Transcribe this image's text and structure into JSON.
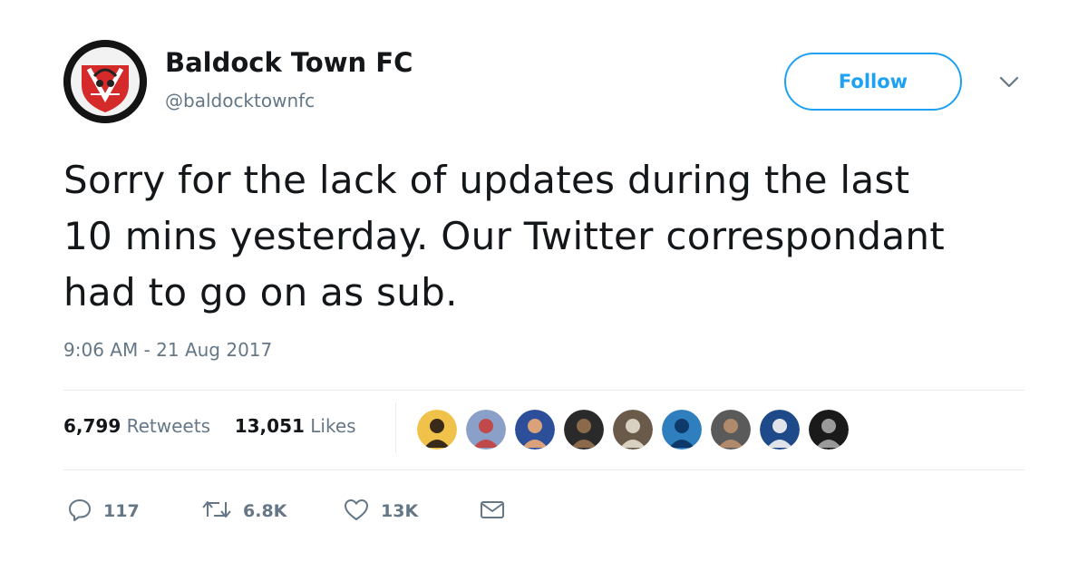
{
  "tweet": {
    "author": {
      "display_name": "Baldock Town FC",
      "handle": "@baldocktownfc",
      "avatar_icon": "club-crest"
    },
    "follow_label": "Follow",
    "menu_icon": "chevron-down-icon",
    "text": "Sorry for the lack of updates during the last\n10 mins yesterday. Our Twitter correspondant\nhad to go on as sub.",
    "timestamp": "9:06 AM - 21 Aug 2017",
    "stats": {
      "retweets_count": "6,799",
      "retweets_label": "Retweets",
      "likes_count": "13,051",
      "likes_label": "Likes"
    },
    "liker_avatars": [
      {
        "colors": [
          "#f0c24a",
          "#3a2a1a"
        ]
      },
      {
        "colors": [
          "#8aa0c8",
          "#c04a4a"
        ]
      },
      {
        "colors": [
          "#2d4f9a",
          "#d9a27a"
        ]
      },
      {
        "colors": [
          "#2a2a2a",
          "#8a6a4a"
        ]
      },
      {
        "colors": [
          "#6a5a4a",
          "#d8d0c0"
        ]
      },
      {
        "colors": [
          "#2f7fbf",
          "#0d3a6a"
        ]
      },
      {
        "colors": [
          "#5a5a5a",
          "#b08a6a"
        ]
      },
      {
        "colors": [
          "#1e4a8a",
          "#e0e4ea"
        ]
      },
      {
        "colors": [
          "#1a1a1a",
          "#9a9a9a"
        ]
      }
    ],
    "actions": {
      "reply_count": "117",
      "retweet_count": "6.8K",
      "like_count": "13K"
    },
    "colors": {
      "accent": "#1da1f2",
      "text": "#14171a",
      "muted": "#657786",
      "divider": "#e6ecf0"
    }
  }
}
